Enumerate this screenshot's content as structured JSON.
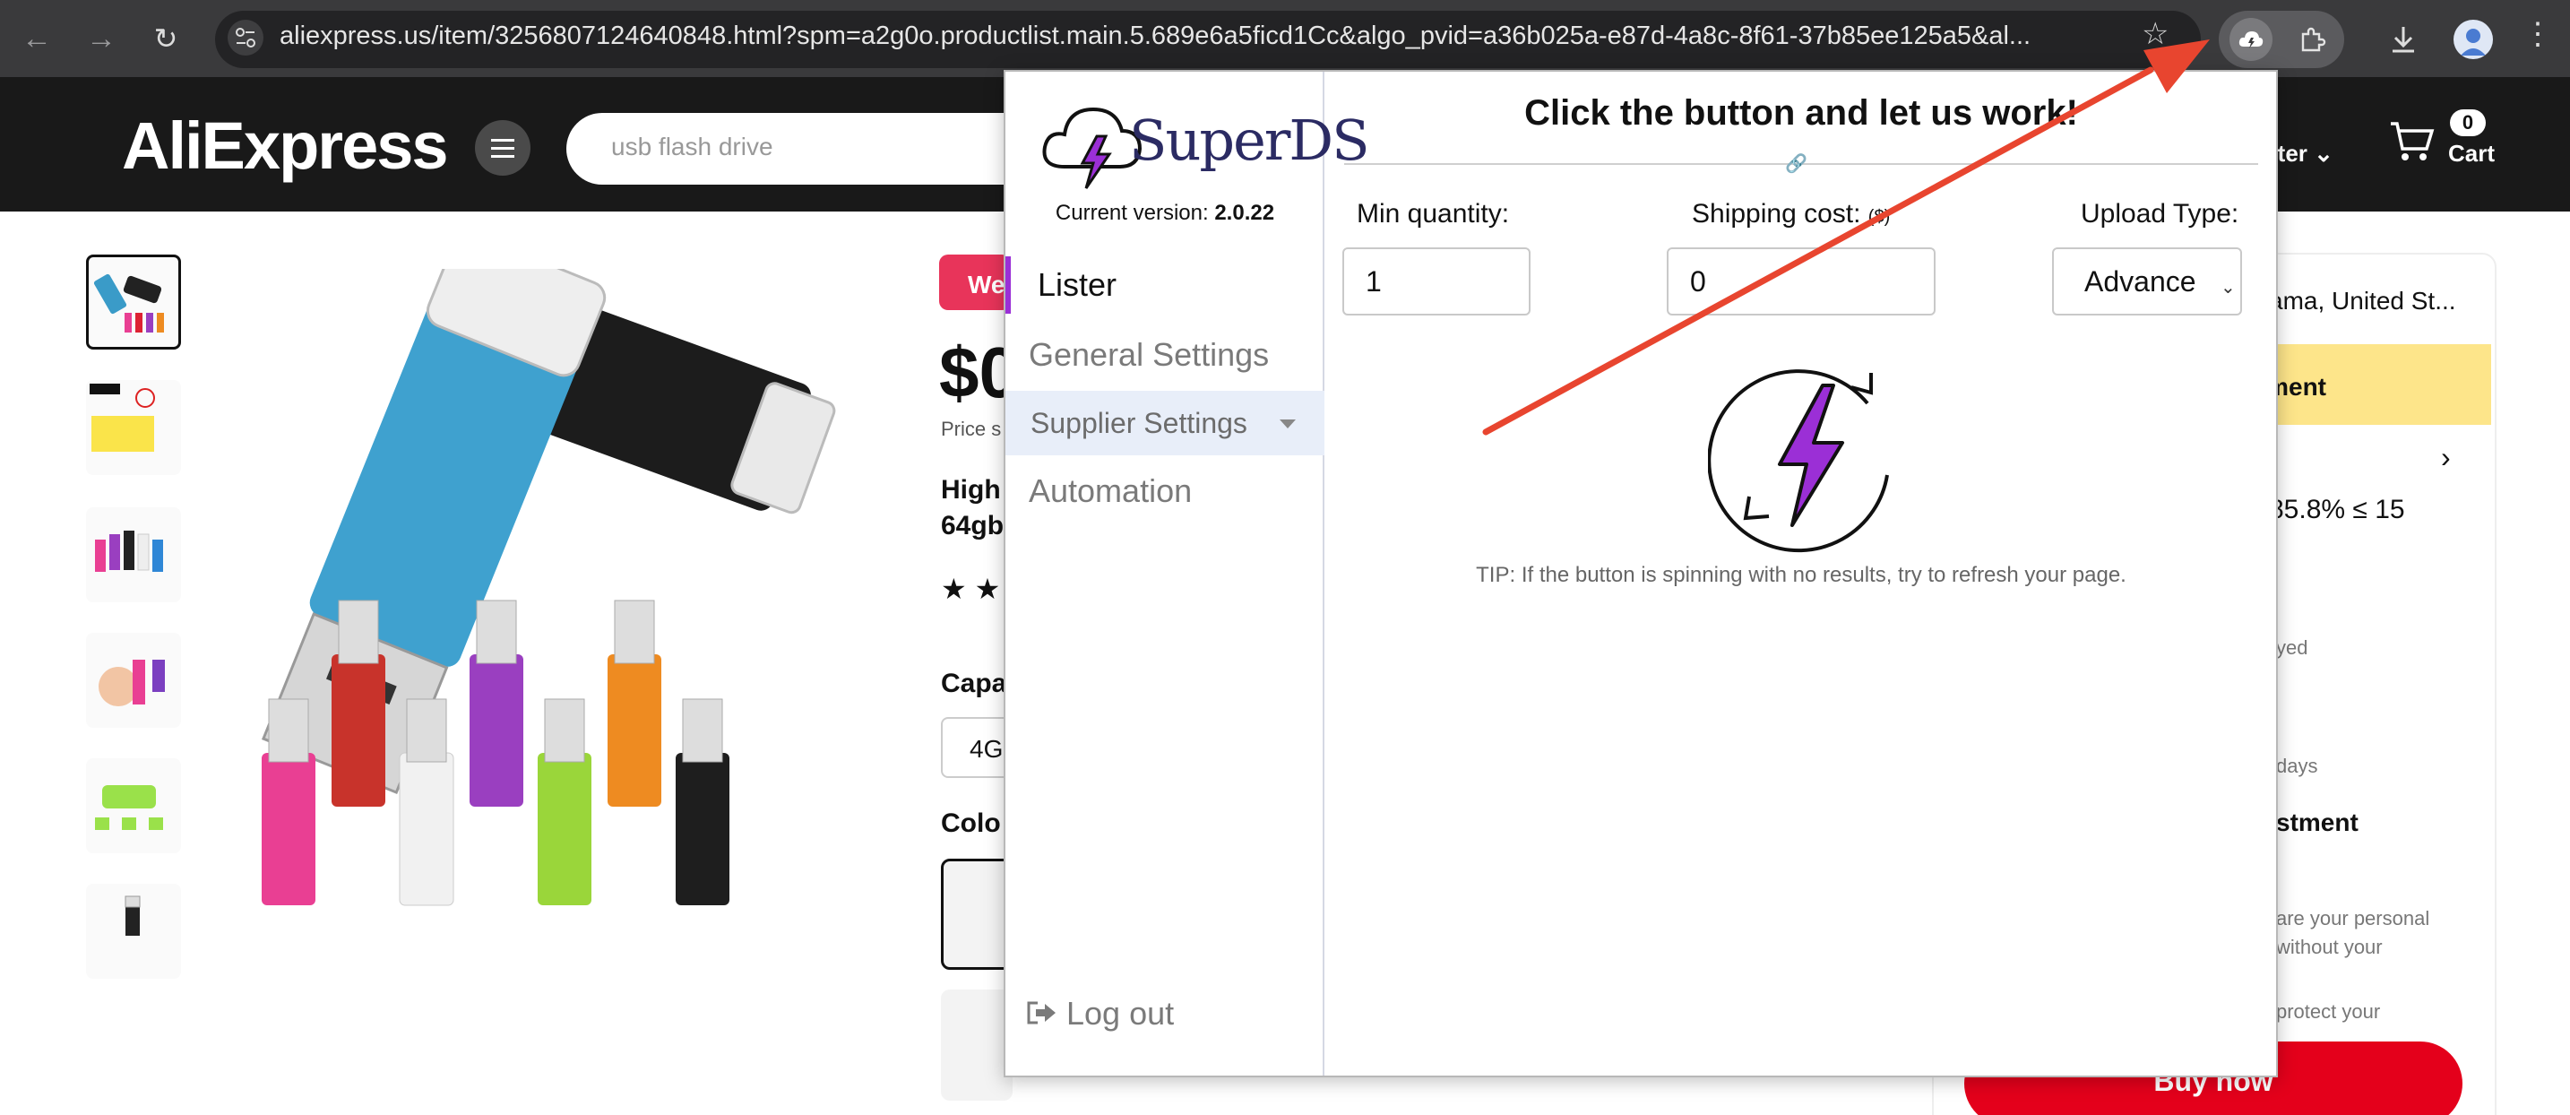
{
  "browser": {
    "url": "aliexpress.us/item/3256807124640848.html?spm=a2g0o.productlist.main.5.689e6a5ficd1Cc&algo_pvid=a36b025a-e87d-4a8c-8f61-37b85ee125a5&al...",
    "icons": [
      "back-icon",
      "forward-icon",
      "reload-icon",
      "site-info-icon",
      "star-icon",
      "superds-extension-icon",
      "puzzle-icon",
      "download-icon",
      "profile-avatar",
      "more-icon"
    ]
  },
  "ali": {
    "logo": "AliExpress",
    "search_placeholder": "usb flash drive",
    "lister_label": "ister",
    "cart_count": "0",
    "cart_label": "Cart",
    "promo_badge": "We",
    "price": "$0",
    "price_sub": "Price s",
    "title_line1": "High",
    "title_line2": "64gb",
    "capacity_label": "Capa",
    "capacity_option": "4G",
    "color_label": "Colo",
    "ship_to": "ama, United St...",
    "commitment": "itment",
    "rate": "85.8% ≤ 15",
    "delayed": "yed",
    "days": "days",
    "adjustment": "stment",
    "privacy1": "are your personal",
    "privacy2": "without your",
    "privacy3": "protect your",
    "buy_now": "Buy now",
    "accent": "#e4001b"
  },
  "superds": {
    "brand": "SuperDS",
    "version_label": "Current version:",
    "version": "2.0.22",
    "nav": {
      "lister": "Lister",
      "general": "General Settings",
      "supplier": "Supplier Settings",
      "automation": "Automation"
    },
    "logout": "Log out",
    "title": "Click the button and let us work!",
    "min_qty_label": "Min quantity:",
    "min_qty_value": "1",
    "shipping_label": "Shipping cost:",
    "shipping_unit": "($)",
    "shipping_value": "0",
    "upload_label": "Upload Type:",
    "upload_value": "Advance",
    "tip": "TIP: If the button is spinning with no results, try to refresh your page.",
    "accent": "#9b2fd6"
  }
}
